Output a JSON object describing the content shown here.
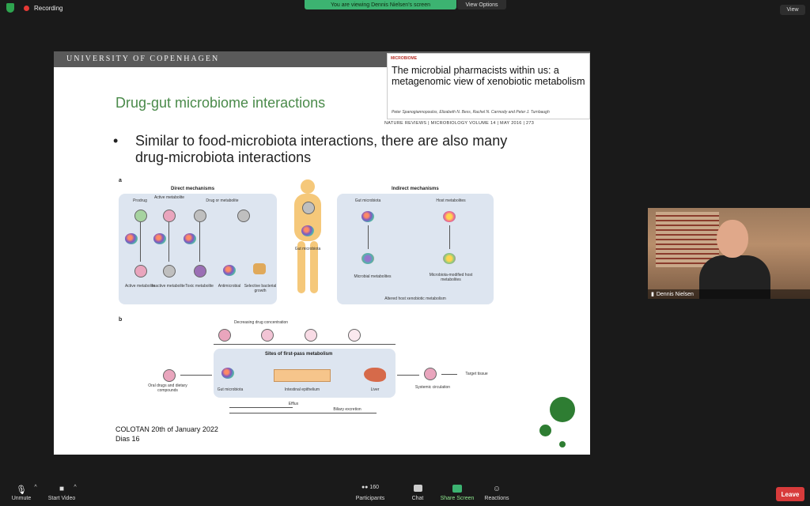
{
  "topbar": {
    "recording": "Recording",
    "viewing": "You are viewing Dennis Nielsen's screen",
    "view_options": "View Options",
    "view": "View"
  },
  "slide": {
    "university": "UNIVERSITY OF COPENHAGEN",
    "citation": {
      "badge": "MICROBIOME",
      "title": "The microbial pharmacists within us: a metagenomic view of xenobiotic metabolism",
      "authors": "Peter Spanogiannopoulos, Elizabeth N. Bess, Rachel N. Carmody and Peter J. Turnbaugh",
      "journal": "NATURE REVIEWS | MICROBIOLOGY   VOLUME 14 | MAY 2016 | 273"
    },
    "title": "Drug-gut microbiome interactions",
    "bullet": "Similar to food-microbiota interactions, there are also many drug-microbiota interactions",
    "figure_a": {
      "label": "a",
      "direct": "Direct mechanisms",
      "indirect": "Indirect mechanisms",
      "prodrug": "Prodrug",
      "active_metabolite_top": "Active metabolite",
      "drug_or_metabolite": "Drug or metabolite",
      "active_metabolite": "Active metabolite",
      "inactive_metabolite": "Inactive metabolite",
      "toxic_metabolite": "Toxic metabolite",
      "antimicrobial": "Antimicrobial",
      "selective_growth": "Selective bacterial growth",
      "gut_microbiota": "Gut microbiota",
      "gut_microbiota_ind": "Gut microbiota",
      "host_metabolites": "Host metabolites",
      "microbial_metabolites": "Microbial metabolites",
      "microbiota_modified": "Microbiota-modified host metabolites",
      "altered": "Altered host xenobiotic metabolism"
    },
    "figure_b": {
      "label": "b",
      "decreasing": "Decreasing drug concentration",
      "sites": "Sites of first-pass metabolism",
      "oral": "Oral drugs and dietary compounds",
      "gut_microbiota": "Gut microbiota",
      "epithelium": "Intestinal epithelium",
      "liver": "Liver",
      "systemic": "Systemic circulation",
      "target": "Target tissue",
      "efflux": "Efflux",
      "biliary": "Biliary excretion"
    },
    "footer_line1": "COLOTAN 20th of January 2022",
    "footer_line2": "Dias 16"
  },
  "participant": {
    "name": "Dennis Nielsen"
  },
  "toolbar": {
    "unmute": "Unmute",
    "start_video": "Start Video",
    "participants": "Participants",
    "participant_count": "160",
    "chat": "Chat",
    "share": "Share Screen",
    "reactions": "Reactions",
    "leave": "Leave"
  },
  "colors": {
    "accent_green": "#4a8a4a",
    "leave_red": "#d83b3b",
    "share_green": "#8fe88f"
  }
}
